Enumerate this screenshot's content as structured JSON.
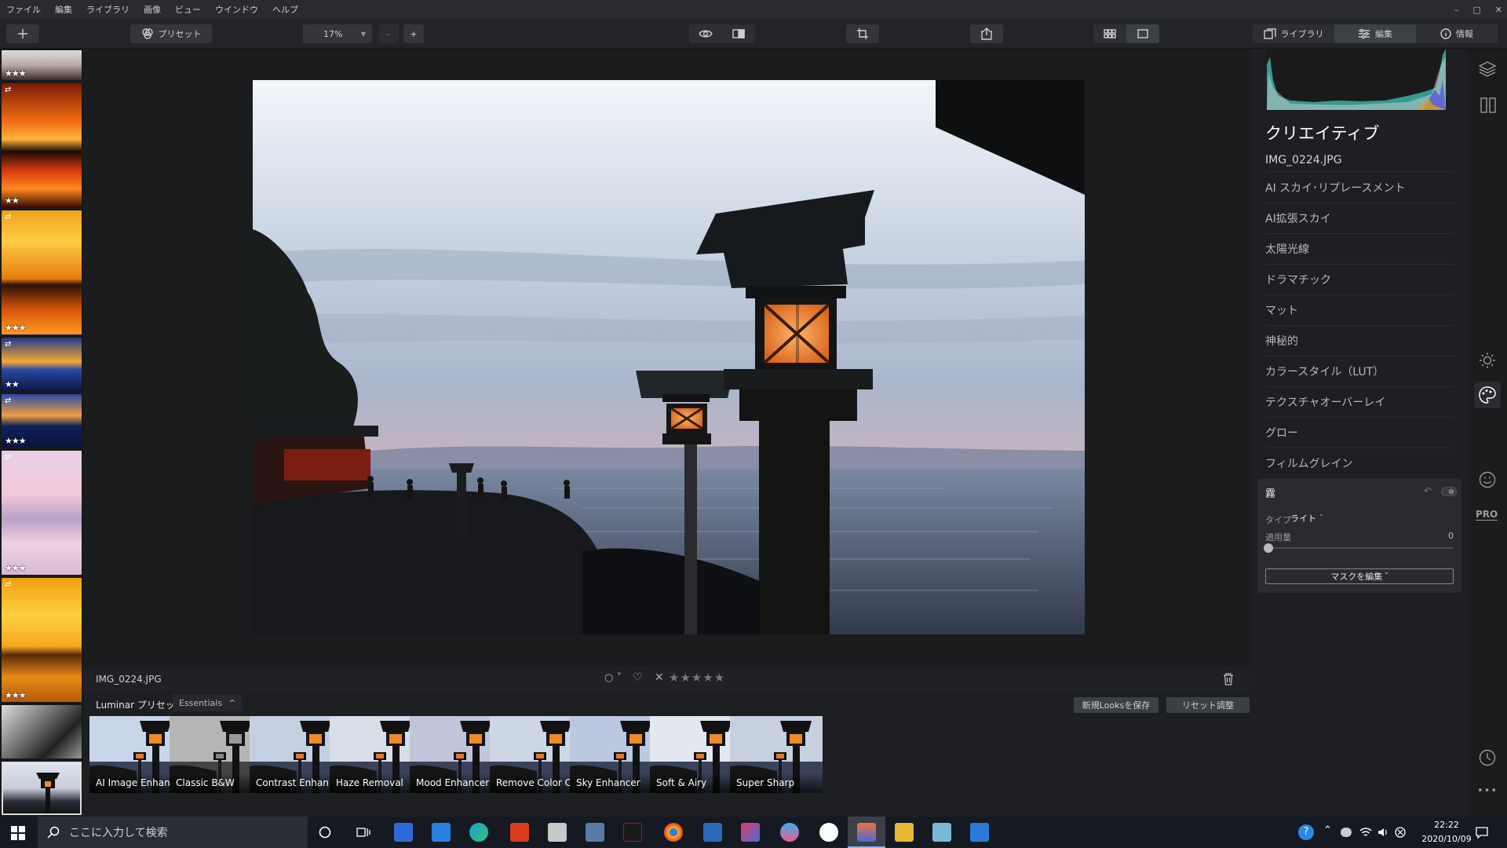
{
  "menu": [
    "ファイル",
    "編集",
    "ライブラリ",
    "画像",
    "ビュー",
    "ウインドウ",
    "ヘルプ"
  ],
  "window_controls": [
    "–",
    "▢",
    "✕"
  ],
  "toolbar": {
    "preset_label": "プリセット",
    "zoom_value": "17%",
    "zoom_minus": "–",
    "zoom_plus": "+",
    "tabs": [
      "ライブラリ",
      "編集",
      "情報"
    ],
    "active_tab": "編集"
  },
  "filmstrip": [
    {
      "stars": "★★★",
      "adjusted": false
    },
    {
      "stars": "★★",
      "adjusted": true
    },
    {
      "stars": "★★★",
      "adjusted": true
    },
    {
      "stars": "★★",
      "adjusted": true
    },
    {
      "stars": "★★★",
      "adjusted": true
    },
    {
      "stars": "★★★",
      "adjusted": true
    },
    {
      "stars": "★★★",
      "adjusted": true
    },
    {
      "stars": "",
      "adjusted": false
    },
    {
      "stars": "",
      "adjusted": false
    }
  ],
  "info": {
    "filename": "IMG_0224.JPG",
    "flag": "○ ˅",
    "rating_stars": "★★★★★"
  },
  "presets": {
    "header": "Luminar プリセット",
    "collection": "Essentials",
    "collection_arrow": "^",
    "save_button": "新規Looksを保存",
    "reset_button": "リセット調整",
    "items": [
      "AI Image Enhan...",
      "Classic B&W",
      "Contrast Enhan...",
      "Haze Removal",
      "Mood Enhancer",
      "Remove Color C...",
      "Sky Enhancer",
      "Soft & Airy",
      "Super Sharp"
    ]
  },
  "panel": {
    "title": "クリエイティブ",
    "filename": "IMG_0224.JPG",
    "tools": [
      "AI スカイ･リプレースメント",
      "AI拡張スカイ",
      "太陽光線",
      "ドラマチック",
      "マット",
      "神秘的",
      "カラースタイル（LUT）",
      "テクスチャオーバーレイ",
      "グロー",
      "フィルムグレイン"
    ],
    "fog": {
      "title": "霧",
      "type_label": "タイプ",
      "type_value": "ライト",
      "type_arrow": "˅",
      "amount_label": "適用量",
      "amount_value": "0",
      "mask_button": "マスクを編集",
      "mask_arrow": "˅"
    }
  },
  "rail": {
    "pro_label": "PRO",
    "more": "•••"
  },
  "taskbar": {
    "search_placeholder": "ここに入力して検索",
    "time": "22:22",
    "date": "2020/10/09"
  }
}
